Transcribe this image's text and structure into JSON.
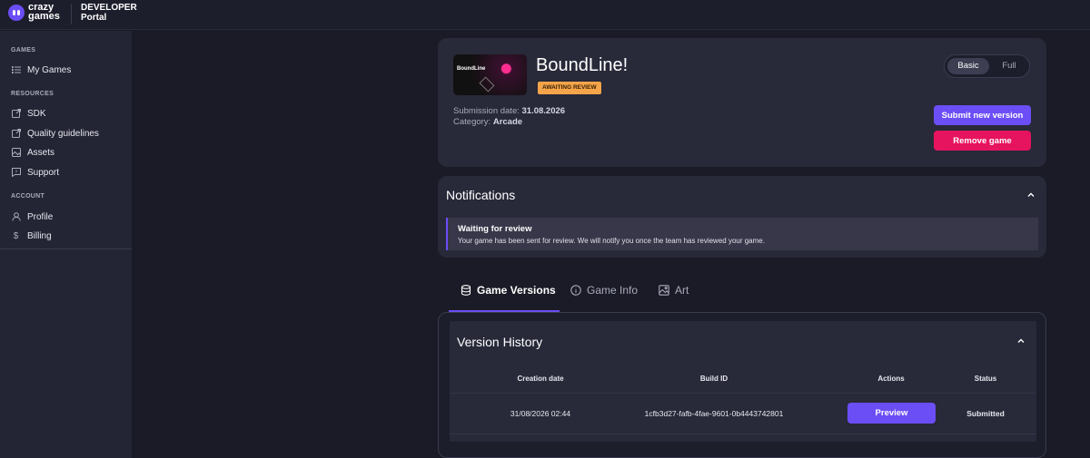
{
  "brand": {
    "line1": "crazy",
    "line2": "games",
    "portal1": "DEVELOPER",
    "portal2": "Portal"
  },
  "sidebar": {
    "sections": [
      {
        "title": "GAMES",
        "items": [
          {
            "label": "My Games",
            "icon": "list-icon"
          }
        ]
      },
      {
        "title": "RESOURCES",
        "items": [
          {
            "label": "SDK",
            "icon": "external-link-icon"
          },
          {
            "label": "Quality guidelines",
            "icon": "external-link-icon"
          },
          {
            "label": "Assets",
            "icon": "image-icon"
          },
          {
            "label": "Support",
            "icon": "chat-icon"
          }
        ]
      },
      {
        "title": "ACCOUNT",
        "items": [
          {
            "label": "Profile",
            "icon": "user-icon"
          },
          {
            "label": "Billing",
            "icon": "dollar-icon"
          }
        ]
      }
    ]
  },
  "game": {
    "thumb_title": "BoundLine",
    "title": "BoundLine!",
    "status": "AWAITING REVIEW",
    "submission_label": "Submission date:",
    "submission_date": "31.08.2026",
    "category_label": "Category:",
    "category": "Arcade",
    "view_toggle": {
      "basic": "Basic",
      "full": "Full",
      "selected": "Basic"
    },
    "submit_label": "Submit new version",
    "remove_label": "Remove game"
  },
  "notifications": {
    "title": "Notifications",
    "items": [
      {
        "title": "Waiting for review",
        "text": "Your game has been sent for review. We will notify you once the team has reviewed your game."
      }
    ]
  },
  "tabs": [
    {
      "label": "Game Versions",
      "icon": "database-icon",
      "active": true
    },
    {
      "label": "Game Info",
      "icon": "info-icon",
      "active": false
    },
    {
      "label": "Art",
      "icon": "image-icon",
      "active": false
    }
  ],
  "versions": {
    "title": "Version History",
    "columns": [
      "Creation date",
      "Build ID",
      "Actions",
      "Status"
    ],
    "rows": [
      {
        "date": "31/08/2026 02:44",
        "build_id": "1cfb3d27-fafb-4fae-9601-0b4443742801",
        "action": "Preview",
        "status": "Submitted"
      }
    ]
  },
  "colors": {
    "accent": "#6b4ef6",
    "danger": "#e6135e",
    "badge": "#f5a44a",
    "background": "#1a1b26",
    "card": "#282939"
  }
}
